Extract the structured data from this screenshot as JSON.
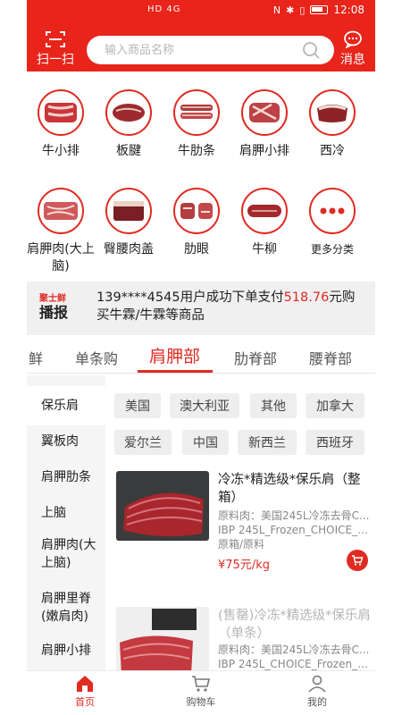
{
  "statusbar": {
    "network": "HD 4G",
    "time": "12:08"
  },
  "header": {
    "scan_label": "扫一扫",
    "search_placeholder": "输入商品名称",
    "message_label": "消息"
  },
  "categories": [
    {
      "label": "牛小排",
      "icon": "beef-rib-image"
    },
    {
      "label": "板腱",
      "icon": "oyster-blade-image"
    },
    {
      "label": "牛肋条",
      "icon": "rib-finger-image"
    },
    {
      "label": "肩胛小排",
      "icon": "chuck-short-rib-image"
    },
    {
      "label": "西冷",
      "icon": "striploin-image"
    },
    {
      "label": "肩胛肉(大上脑)",
      "icon": "chuck-roll-image"
    },
    {
      "label": "臀腰肉盖",
      "icon": "rump-cap-image"
    },
    {
      "label": "肋眼",
      "icon": "ribeye-image"
    },
    {
      "label": "牛柳",
      "icon": "tenderloin-image"
    },
    {
      "label": "更多分类",
      "icon": "more-dots-icon"
    }
  ],
  "notice": {
    "logo_top": "聚士鲜",
    "logo_bottom": "播报",
    "text_before": "139****4545用户成功下单支付",
    "amount": "518.76",
    "text_after": "元购买牛霖/牛霖等商品"
  },
  "tabs": [
    {
      "label": "鲜",
      "active": false
    },
    {
      "label": "单条购",
      "active": false
    },
    {
      "label": "肩胛部",
      "active": true
    },
    {
      "label": "肋脊部",
      "active": false
    },
    {
      "label": "腰脊部",
      "active": false
    }
  ],
  "side_menu": [
    {
      "label": "保乐肩",
      "active": true
    },
    {
      "label": "翼板肉",
      "active": false
    },
    {
      "label": "肩胛肋条",
      "active": false
    },
    {
      "label": "上脑",
      "active": false
    },
    {
      "label": "肩胛肉(大上脑)",
      "active": false
    },
    {
      "label": "肩胛里脊(嫩肩肉)",
      "active": false
    },
    {
      "label": "肩胛小排",
      "active": false
    }
  ],
  "filters": [
    "美国",
    "澳大利亚",
    "其他",
    "加拿大",
    "爱尔兰",
    "中国",
    "新西兰",
    "西班牙"
  ],
  "products": [
    {
      "title": "冷冻*精选级*保乐肩（整箱）",
      "raw_material": "原料肉：美国245L冷冻去骨C...",
      "spec": "IBP 245L_Frozen_CHOICE_C...",
      "packaging": "原箱/原料",
      "price": "¥75元/kg",
      "sold_out": false
    },
    {
      "title": "(售罄)冷冻*精选级*保乐肩（单条）",
      "raw_material": "原料肉：美国245L冷冻去骨C...",
      "spec": "IBP 245L_CHOICE_Frozen_C...",
      "sold_out": true
    }
  ],
  "bottom_nav": [
    {
      "label": "首页",
      "icon": "home-icon",
      "active": true
    },
    {
      "label": "购物车",
      "icon": "cart-icon",
      "active": false
    },
    {
      "label": "我的",
      "icon": "user-icon",
      "active": false
    }
  ],
  "colors": {
    "brand_red": "#e8241b",
    "accent_red": "#e02b22",
    "panel_gray": "#f0f0f0"
  }
}
